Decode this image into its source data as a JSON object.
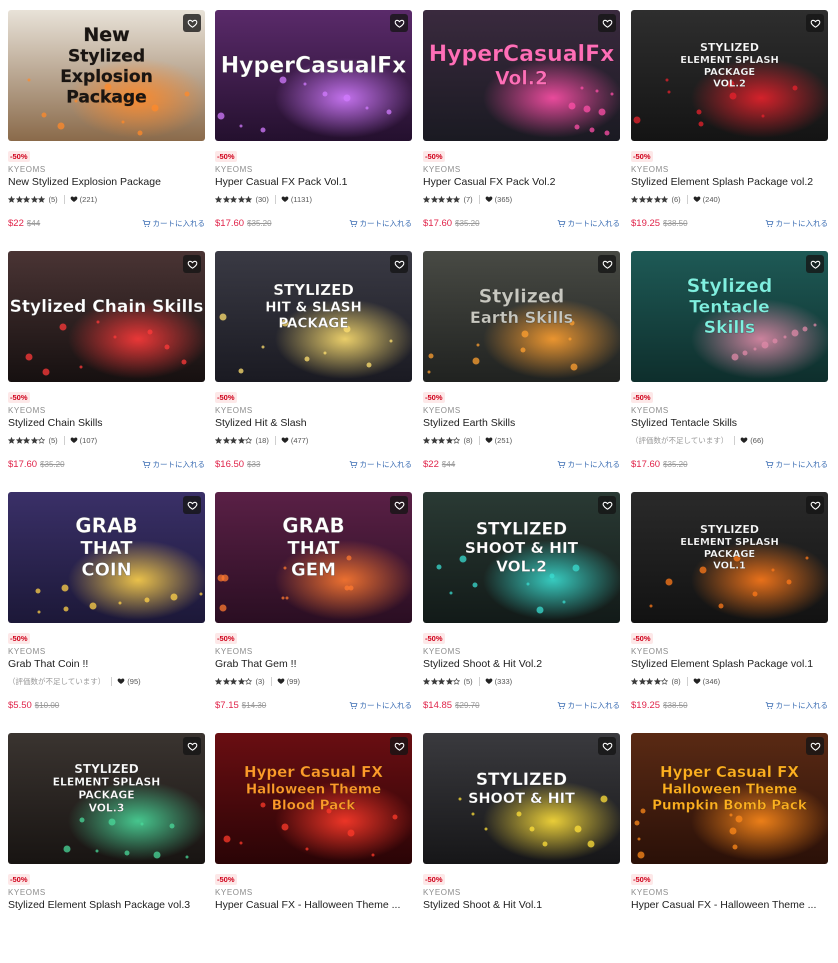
{
  "cart_label": "カートに入れる",
  "colors": {
    "sale": "#e0244a",
    "badge_bg": "#fde8e8",
    "badge_text": "#d0021b",
    "cart": "#3b6db3"
  },
  "products": [
    {
      "discount": "-50%",
      "publisher": "KYEOMS",
      "title": "New Stylized Explosion Package",
      "stars": 5,
      "rating_count": "(5)",
      "no_rating": "",
      "favorites": "(221)",
      "price": "$22",
      "original_price": "$44",
      "has_cart": true,
      "thumb": {
        "bg1": "#e8e2d8",
        "bg2": "#8a6a4a",
        "glow": "#ff8a2a",
        "lines": [
          "New",
          "Stylized",
          "Explosion",
          "Package"
        ],
        "text_color": "#1a1512",
        "font_size": 19
      }
    },
    {
      "discount": "-50%",
      "publisher": "KYEOMS",
      "title": "Hyper Casual FX Pack Vol.1",
      "stars": 5,
      "rating_count": "(30)",
      "no_rating": "",
      "favorites": "(1131)",
      "price": "$17.60",
      "original_price": "$35.20",
      "has_cart": true,
      "thumb": {
        "bg1": "#5a2a6a",
        "bg2": "#24102e",
        "glow": "#d27bff",
        "lines": [
          "HyperCasualFx"
        ],
        "text_color": "#ffffff",
        "font_size": 22
      }
    },
    {
      "discount": "-50%",
      "publisher": "KYEOMS",
      "title": "Hyper Casual FX Pack Vol.2",
      "stars": 5,
      "rating_count": "(7)",
      "no_rating": "",
      "favorites": "(365)",
      "price": "$17.60",
      "original_price": "$35.20",
      "has_cart": true,
      "thumb": {
        "bg1": "#3a2a3e",
        "bg2": "#1a1a22",
        "glow": "#ff4fa8",
        "lines": [
          "HyperCasualFx",
          "Vol.2"
        ],
        "text_color": "#ff6fb8",
        "font_size": 22
      }
    },
    {
      "discount": "-50%",
      "publisher": "KYEOMS",
      "title": "Stylized Element Splash Package vol.2",
      "stars": 5,
      "rating_count": "(6)",
      "no_rating": "",
      "favorites": "(240)",
      "price": "$19.25",
      "original_price": "$38.50",
      "has_cart": true,
      "thumb": {
        "bg1": "#2e2e2e",
        "bg2": "#141414",
        "glow": "#e8222c",
        "lines": [
          "STYLIZED",
          "ELEMENT SPLASH",
          "PACKAGE",
          "VOL.2"
        ],
        "text_color": "#ffffff",
        "font_size": 11
      }
    },
    {
      "discount": "-50%",
      "publisher": "KYEOMS",
      "title": "Stylized Chain Skills",
      "stars": 4,
      "rating_count": "(5)",
      "no_rating": "",
      "favorites": "(107)",
      "price": "$17.60",
      "original_price": "$35.20",
      "has_cart": true,
      "thumb": {
        "bg1": "#4a3434",
        "bg2": "#161010",
        "glow": "#ff3a3a",
        "lines": [
          "Stylized Chain Skills"
        ],
        "text_color": "#ffffff",
        "font_size": 17
      }
    },
    {
      "discount": "-50%",
      "publisher": "KYEOMS",
      "title": "Stylized Hit & Slash",
      "stars": 4,
      "rating_count": "(18)",
      "no_rating": "",
      "favorites": "(477)",
      "price": "$16.50",
      "original_price": "$33",
      "has_cart": true,
      "thumb": {
        "bg1": "#3a3a44",
        "bg2": "#1a1a22",
        "glow": "#ffe070",
        "lines": [
          "STYLIZED",
          "HIT & SLASH",
          "PACKAGE"
        ],
        "text_color": "#ffffff",
        "font_size": 15
      }
    },
    {
      "discount": "-50%",
      "publisher": "KYEOMS",
      "title": "Stylized Earth Skills",
      "stars": 4,
      "rating_count": "(8)",
      "no_rating": "",
      "favorites": "(251)",
      "price": "$22",
      "original_price": "$44",
      "has_cart": true,
      "thumb": {
        "bg1": "#484a44",
        "bg2": "#202220",
        "glow": "#ffa030",
        "lines": [
          "Stylized",
          "Earth Skills"
        ],
        "text_color": "#c8c8c0",
        "font_size": 19
      }
    },
    {
      "discount": "-50%",
      "publisher": "KYEOMS",
      "title": "Stylized Tentacle Skills",
      "stars": 0,
      "rating_count": "",
      "no_rating": "（評価数が不足しています）",
      "favorites": "(66)",
      "price": "$17.60",
      "original_price": "$35.20",
      "has_cart": true,
      "thumb": {
        "bg1": "#1e5a56",
        "bg2": "#0e2e2c",
        "glow": "#e08aa8",
        "lines": [
          "Stylized",
          "Tentacle",
          "Skills"
        ],
        "text_color": "#7ff0e0",
        "font_size": 19
      }
    },
    {
      "discount": "-50%",
      "publisher": "KYEOMS",
      "title": "Grab That Coin !!",
      "stars": 0,
      "rating_count": "",
      "no_rating": "（評価数が不足しています）",
      "favorites": "(95)",
      "price": "$5.50",
      "original_price": "$10.00",
      "has_cart": false,
      "thumb": {
        "bg1": "#3a3068",
        "bg2": "#1c1838",
        "glow": "#ffd24a",
        "lines": [
          "GRAB",
          "THAT",
          "COIN"
        ],
        "text_color": "#ffffff",
        "font_size": 20
      }
    },
    {
      "discount": "-50%",
      "publisher": "KYEOMS",
      "title": "Grab That Gem !!",
      "stars": 4,
      "rating_count": "(3)",
      "no_rating": "",
      "favorites": "(99)",
      "price": "$7.15",
      "original_price": "$14.30",
      "has_cart": true,
      "thumb": {
        "bg1": "#5a2046",
        "bg2": "#2a0e22",
        "glow": "#ff7a30",
        "lines": [
          "GRAB",
          "THAT",
          "GEM"
        ],
        "text_color": "#ffffff",
        "font_size": 20
      }
    },
    {
      "discount": "-50%",
      "publisher": "KYEOMS",
      "title": "Stylized Shoot & Hit Vol.2",
      "stars": 4,
      "rating_count": "(5)",
      "no_rating": "",
      "favorites": "(333)",
      "price": "$14.85",
      "original_price": "$29.70",
      "has_cart": true,
      "thumb": {
        "bg1": "#2a3a34",
        "bg2": "#121a18",
        "glow": "#3adcd0",
        "lines": [
          "STYLIZED",
          "SHOOT & HIT",
          "VOL.2"
        ],
        "text_color": "#ffffff",
        "font_size": 17
      }
    },
    {
      "discount": "-50%",
      "publisher": "KYEOMS",
      "title": "Stylized Element Splash Package vol.1",
      "stars": 4,
      "rating_count": "(8)",
      "no_rating": "",
      "favorites": "(346)",
      "price": "$19.25",
      "original_price": "$38.50",
      "has_cart": true,
      "thumb": {
        "bg1": "#2a2a2a",
        "bg2": "#121212",
        "glow": "#ff7a1a",
        "lines": [
          "STYLIZED",
          "ELEMENT SPLASH",
          "PACKAGE",
          "VOL.1"
        ],
        "text_color": "#ffffff",
        "font_size": 11
      }
    },
    {
      "discount": "-50%",
      "publisher": "KYEOMS",
      "title": "Stylized Element Splash Package vol.3",
      "stars": 0,
      "rating_count": "",
      "no_rating": "",
      "favorites": "",
      "price": "",
      "original_price": "",
      "has_cart": false,
      "thumb": {
        "bg1": "#3a3430",
        "bg2": "#181412",
        "glow": "#4ad89a",
        "lines": [
          "STYLIZED",
          "ELEMENT SPLASH",
          "PACKAGE",
          "VOL.3"
        ],
        "text_color": "#ffffff",
        "font_size": 12
      }
    },
    {
      "discount": "-50%",
      "publisher": "KYEOMS",
      "title": "Hyper Casual FX - Halloween Theme ...",
      "stars": 0,
      "rating_count": "",
      "no_rating": "",
      "favorites": "",
      "price": "",
      "original_price": "",
      "has_cart": false,
      "thumb": {
        "bg1": "#6a0e12",
        "bg2": "#2a0406",
        "glow": "#ff3a2a",
        "lines": [
          "Hyper Casual FX",
          "Halloween Theme",
          "Blood Pack"
        ],
        "text_color": "#ff9a2a",
        "font_size": 15
      }
    },
    {
      "discount": "-50%",
      "publisher": "KYEOMS",
      "title": "Stylized Shoot & Hit Vol.1",
      "stars": 0,
      "rating_count": "",
      "no_rating": "",
      "favorites": "",
      "price": "",
      "original_price": "",
      "has_cart": false,
      "thumb": {
        "bg1": "#3a3a3e",
        "bg2": "#161618",
        "glow": "#ffe03a",
        "lines": [
          "STYLIZED",
          "SHOOT & HIT"
        ],
        "text_color": "#ffffff",
        "font_size": 17
      }
    },
    {
      "discount": "-50%",
      "publisher": "KYEOMS",
      "title": "Hyper Casual FX - Halloween Theme ...",
      "stars": 0,
      "rating_count": "",
      "no_rating": "",
      "favorites": "",
      "price": "",
      "original_price": "",
      "has_cart": false,
      "thumb": {
        "bg1": "#5a2a14",
        "bg2": "#2a1008",
        "glow": "#ff8a1a",
        "lines": [
          "Hyper Casual FX",
          "Halloween Theme",
          "Pumpkin Bomb Pack"
        ],
        "text_color": "#ffb020",
        "font_size": 15
      }
    }
  ]
}
